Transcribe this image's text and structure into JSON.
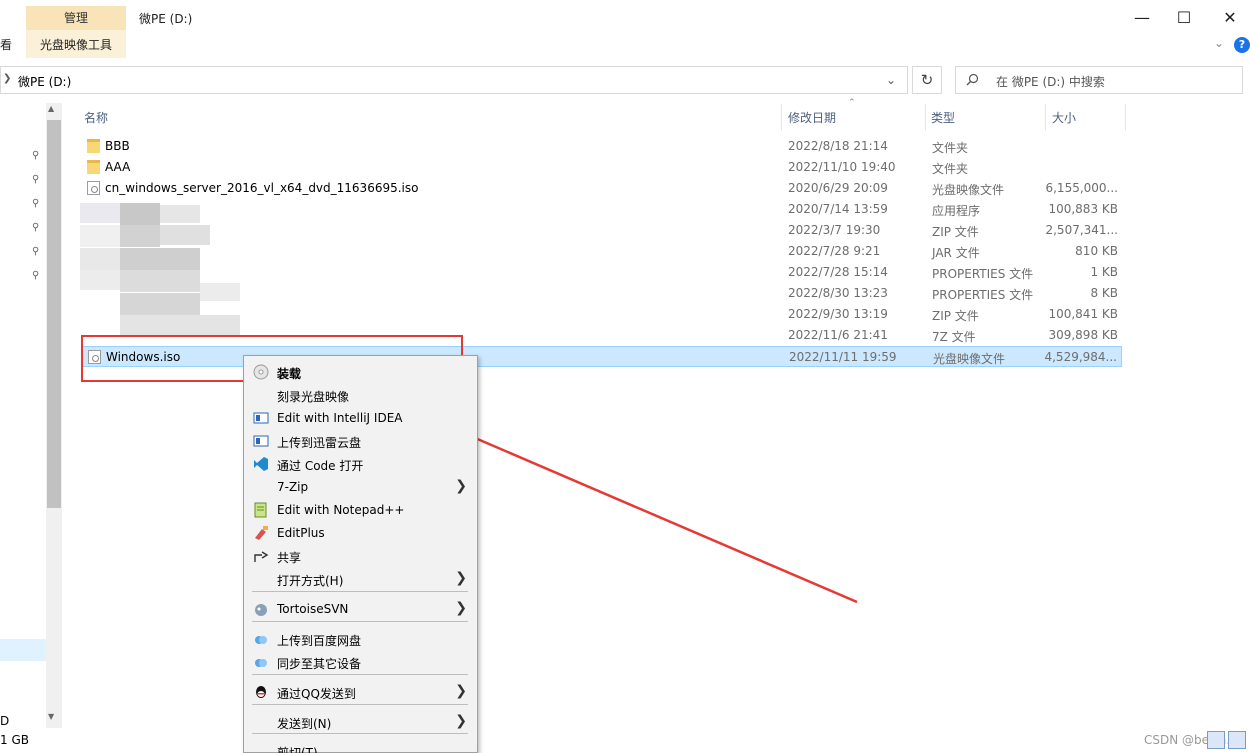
{
  "ribbon": {
    "tab_manage": "管理",
    "tab_tools": "光盘映像工具",
    "tab_view_partial": "看"
  },
  "window": {
    "title": "微PE (D:)"
  },
  "address": {
    "path": "微PE (D:)"
  },
  "search": {
    "placeholder": "在 微PE (D:) 中搜索"
  },
  "columns": {
    "name": "名称",
    "date": "修改日期",
    "type": "类型",
    "size": "大小"
  },
  "files": [
    {
      "name": "BBB",
      "date": "2022/8/18 21:14",
      "type": "文件夹",
      "size": "",
      "icon": "folder-icon"
    },
    {
      "name": "AAA",
      "date": "2022/11/10 19:40",
      "type": "文件夹",
      "size": "",
      "icon": "folder-icon"
    },
    {
      "name": "cn_windows_server_2016_vl_x64_dvd_11636695.iso",
      "date": "2020/6/29 20:09",
      "type": "光盘映像文件",
      "size": "6,155,000...",
      "icon": "iso-icon"
    },
    {
      "name": "",
      "date": "2020/7/14 13:59",
      "type": "应用程序",
      "size": "100,883 KB",
      "icon": "blurred"
    },
    {
      "name": "",
      "date": "2022/3/7 19:30",
      "type": "ZIP 文件",
      "size": "2,507,341...",
      "icon": "blurred"
    },
    {
      "name": "",
      "date": "2022/7/28 9:21",
      "type": "JAR 文件",
      "size": "810 KB",
      "icon": "blurred"
    },
    {
      "name": "",
      "date": "2022/7/28 15:14",
      "type": "PROPERTIES 文件",
      "size": "1 KB",
      "icon": "blurred"
    },
    {
      "name": "",
      "date": "2022/8/30 13:23",
      "type": "PROPERTIES 文件",
      "size": "8 KB",
      "icon": "blurred"
    },
    {
      "name": "",
      "date": "2022/9/30 13:19",
      "type": "ZIP 文件",
      "size": "100,841 KB",
      "icon": "blurred"
    },
    {
      "name": "",
      "date": "2022/11/6 21:41",
      "type": "7Z 文件",
      "size": "309,898 KB",
      "icon": "blurred"
    },
    {
      "name": "Windows.iso",
      "date": "2022/11/11 19:59",
      "type": "光盘映像文件",
      "size": "4,529,984...",
      "icon": "iso-icon",
      "selected": true
    }
  ],
  "nav": {
    "bottom_line1": "D",
    "bottom_line2": "1 GB"
  },
  "context_menu": {
    "items": [
      {
        "label": "装载",
        "icon": "disc-icon",
        "bold": true
      },
      {
        "label": "刻录光盘映像",
        "icon": ""
      },
      {
        "label": "Edit with IntelliJ IDEA",
        "icon": "intellij-icon"
      },
      {
        "label": "上传到迅雷云盘",
        "icon": "thunder-cloud-icon"
      },
      {
        "label": "通过 Code 打开",
        "icon": "vscode-icon"
      },
      {
        "label": "7-Zip",
        "icon": "",
        "submenu": true
      },
      {
        "label": "Edit with Notepad++",
        "icon": "notepadpp-icon"
      },
      {
        "label": "EditPlus",
        "icon": "editplus-icon"
      },
      {
        "label": "共享",
        "icon": "share-icon"
      },
      {
        "label": "打开方式(H)",
        "icon": "",
        "submenu": true
      },
      {
        "label": "TortoiseSVN",
        "icon": "tortoisesvn-icon",
        "submenu": true
      },
      {
        "label": "上传到百度网盘",
        "icon": "baidu-netdisk-icon"
      },
      {
        "label": "同步至其它设备",
        "icon": "baidu-sync-icon"
      },
      {
        "label": "通过QQ发送到",
        "icon": "qq-icon",
        "submenu": true
      },
      {
        "label": "发送到(N)",
        "icon": "",
        "submenu": true
      },
      {
        "label": "剪切(T)",
        "icon": ""
      }
    ]
  },
  "watermark": "CSDN @beijia...",
  "colors": {
    "selection": "#cce8ff",
    "annotation_red": "#e53935",
    "ribbon_highlight": "#f8e4b8"
  }
}
